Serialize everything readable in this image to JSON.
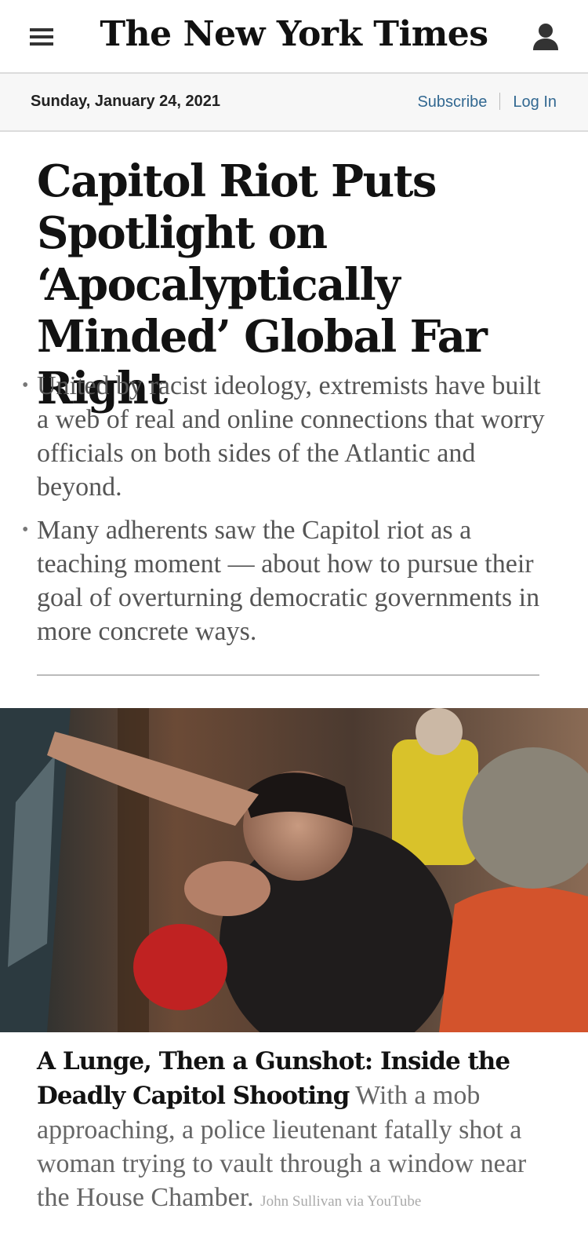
{
  "masthead": {
    "logo_text": "The New York Times",
    "menu_icon": "hamburger-menu-icon",
    "account_icon": "user-account-icon"
  },
  "datebar": {
    "date": "Sunday, January 24, 2021",
    "subscribe_label": "Subscribe",
    "login_label": "Log In"
  },
  "lead_story": {
    "headline": "Capitol Riot Puts Spotlight on ‘Apocalyptically Minded’ Global Far Right",
    "summary": [
      "United by racist ideology, extremists have built a web of real and online connections that worry officials on both sides of the Atlantic and beyond.",
      "Many adherents saw the Capitol riot as a teaching moment — about how to pursue their goal of overturning democratic governments in more concrete ways."
    ]
  },
  "second_story": {
    "headline": "A Lunge, Then a Gunshot: Inside the Deadly Capitol Shooting",
    "summary": "With a mob approaching, a police lieutenant fatally shot a woman trying to vault through a window near the House Chamber.",
    "photo_credit": "John Sullivan via YouTube"
  },
  "colors": {
    "link_blue": "#326891",
    "headline_black": "#121212",
    "summary_gray": "#555555",
    "datebar_bg": "#f7f7f7"
  }
}
